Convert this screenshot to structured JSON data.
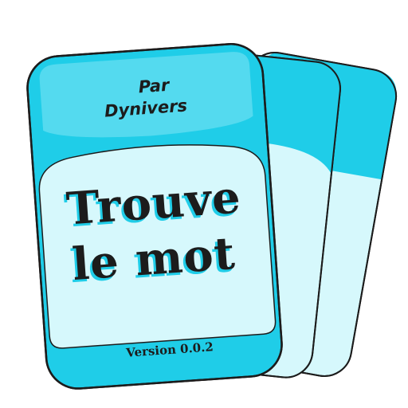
{
  "logo": {
    "author_prefix": "Par",
    "author_name": "Dynivers",
    "title_line1": "Trouve",
    "title_line2": "le mot",
    "version": "Version 0.0.2"
  },
  "colors": {
    "card_band": "#1fcde8",
    "card_body": "#d6f8fc",
    "outline": "#1c1c1c",
    "text": "#1c1c1c",
    "title_shadow": "#1fcde8"
  },
  "icons": [
    "card-stack-icon"
  ]
}
